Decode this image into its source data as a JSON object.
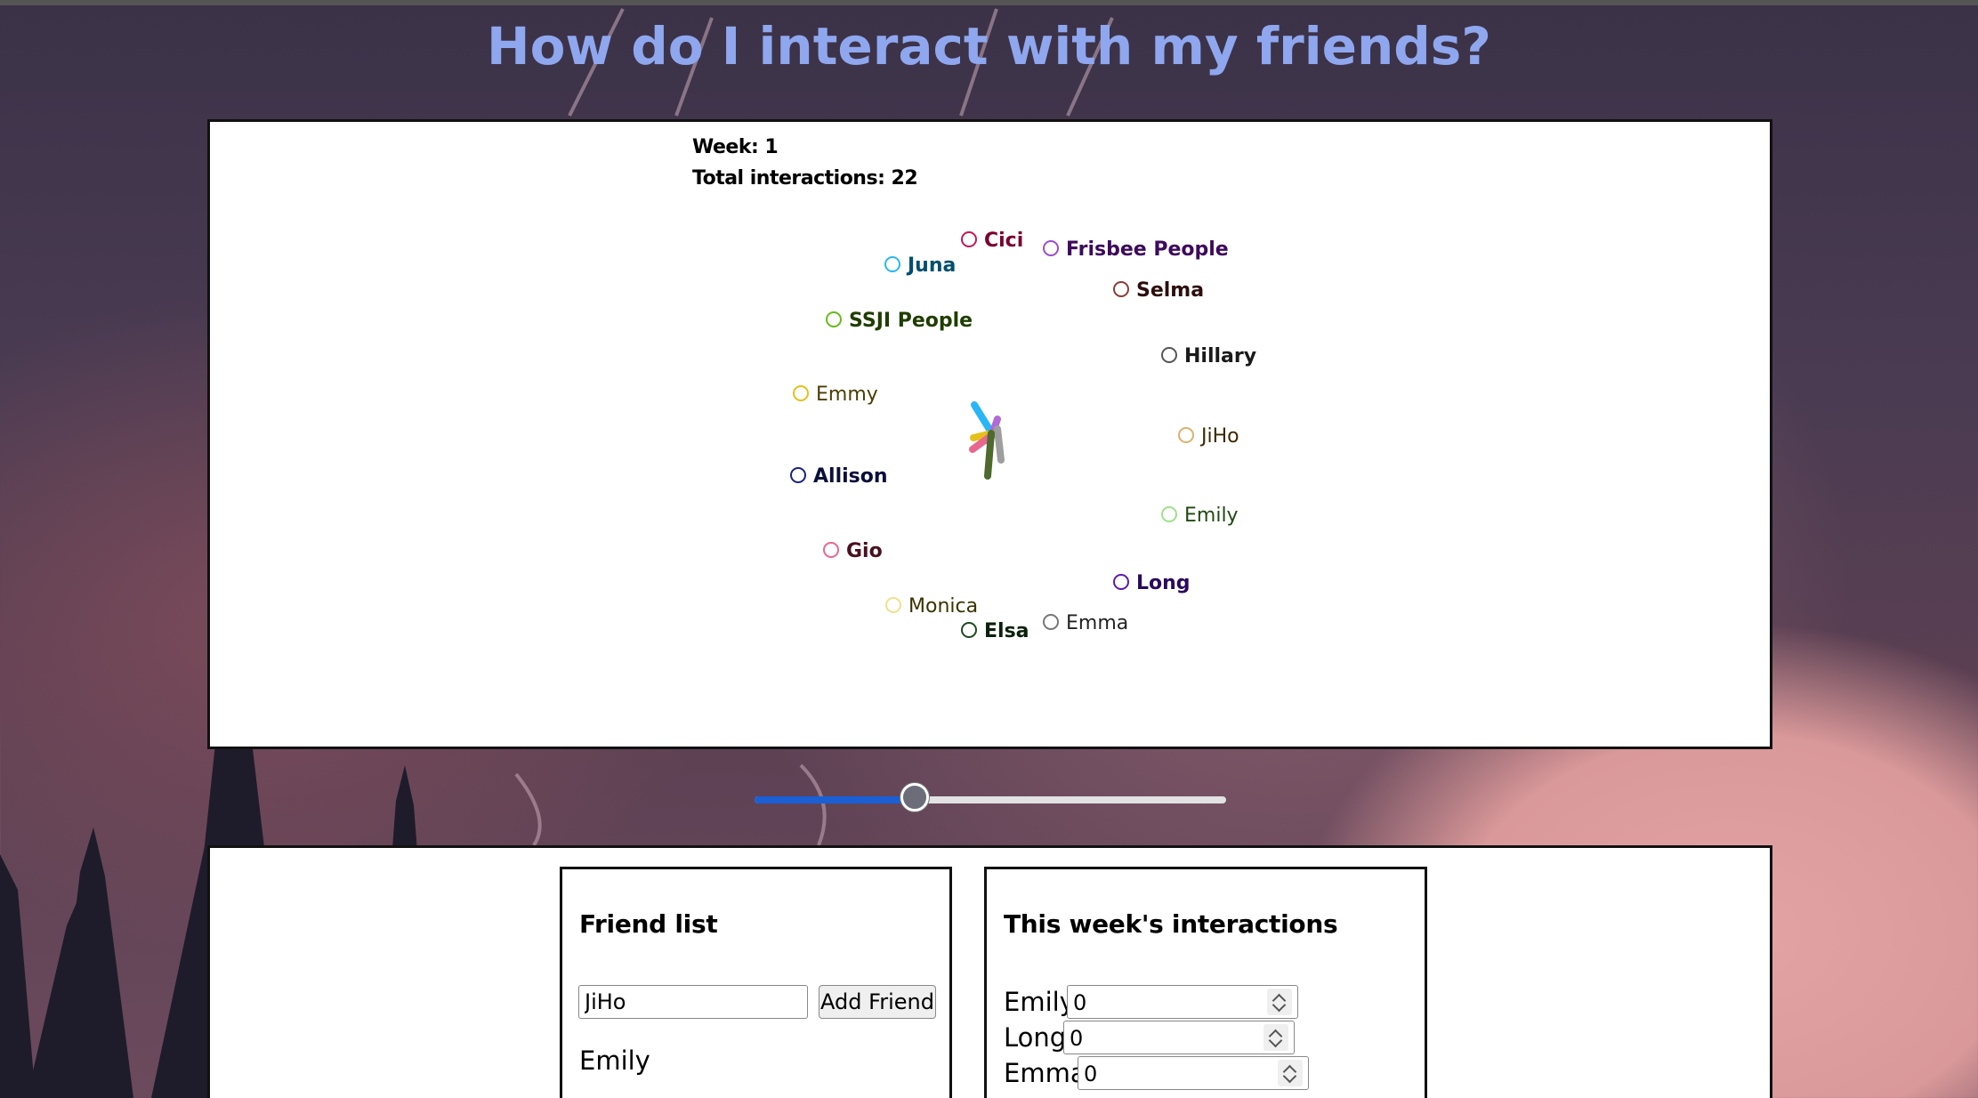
{
  "page": {
    "title": "How do I interact with my friends?"
  },
  "stats": {
    "week_label": "Week: 1",
    "total_label": "Total interactions: 22"
  },
  "nodes": [
    {
      "name": "Cici",
      "color": "#c2185b",
      "text_color": "#7a0030",
      "bold": true
    },
    {
      "name": "Frisbee People",
      "color": "#9c4dcc",
      "text_color": "#3d0a5c",
      "bold": true
    },
    {
      "name": "Juna",
      "color": "#29b6f6",
      "text_color": "#014f6e",
      "bold": true
    },
    {
      "name": "Selma",
      "color": "#8d3b3b",
      "text_color": "#2e0d0d",
      "bold": true
    },
    {
      "name": "SSJI People",
      "color": "#66bb1a",
      "text_color": "#1f3d00",
      "bold": true
    },
    {
      "name": "Hillary",
      "color": "#555555",
      "text_color": "#1a1a1a",
      "bold": true
    },
    {
      "name": "Emmy",
      "color": "#e6c01a",
      "text_color": "#4a3d00",
      "bold": false
    },
    {
      "name": "JiHo",
      "color": "#e0b070",
      "text_color": "#3a2a00",
      "bold": false
    },
    {
      "name": "Allison",
      "color": "#1a237e",
      "text_color": "#0a0f3a",
      "bold": true
    },
    {
      "name": "Emily",
      "color": "#9ee08a",
      "text_color": "#1f4a10",
      "bold": false
    },
    {
      "name": "Gio",
      "color": "#e8678f",
      "text_color": "#4a1020",
      "bold": true
    },
    {
      "name": "Long",
      "color": "#5e1ab0",
      "text_color": "#2a0a5e",
      "bold": true
    },
    {
      "name": "Monica",
      "color": "#f0e08a",
      "text_color": "#3a3300",
      "bold": false
    },
    {
      "name": "Elsa",
      "color": "#1f4a1f",
      "text_color": "#0a200a",
      "bold": true
    },
    {
      "name": "Emma",
      "color": "#777777",
      "text_color": "#222222",
      "bold": false
    }
  ],
  "center_lines": [
    {
      "color": "#29b6f6"
    },
    {
      "color": "#b06ad8"
    },
    {
      "color": "#e6c01a"
    },
    {
      "color": "#e8678f"
    },
    {
      "color": "#9e9e9e"
    },
    {
      "color": "#4e6a2e"
    }
  ],
  "slider": {
    "value_fraction": 0.34
  },
  "friend_list": {
    "heading": "Friend list",
    "input_value": "JiHo",
    "button_label": "Add Friend",
    "friends": [
      "Emily"
    ]
  },
  "interactions": {
    "heading": "This week's interactions",
    "rows": [
      {
        "name": "Emily",
        "value": "0"
      },
      {
        "name": "Long",
        "value": "0"
      },
      {
        "name": "Emma",
        "value": "0"
      }
    ]
  }
}
